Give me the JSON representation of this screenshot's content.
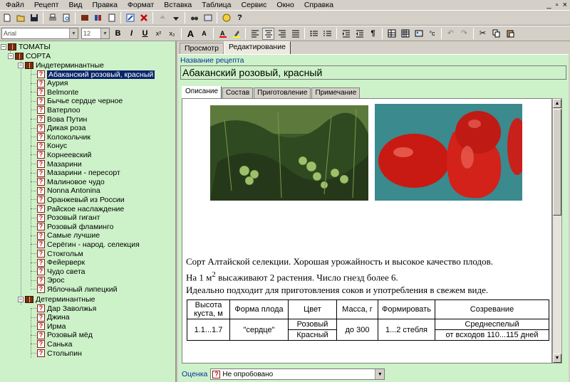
{
  "menu": {
    "items": [
      "Файл",
      "Рецепт",
      "Вид",
      "Правка",
      "Формат",
      "Вставка",
      "Таблица",
      "Сервис",
      "Окно",
      "Справка"
    ],
    "window_controls": [
      "_",
      "▫",
      "×"
    ]
  },
  "format_bar": {
    "font": "Arial",
    "font_size": "12",
    "bold": "B",
    "italic": "I",
    "underline": "U",
    "superscript": "x²",
    "subscript": "x₂",
    "grow_font": "A",
    "shrink_font": "A"
  },
  "tree": {
    "root": "ТОМАТЫ",
    "category": "СОРТА",
    "groups": [
      {
        "label": "Индетерминантные",
        "items": [
          "Абаканский розовый, красный",
          "Аурия",
          "Belmonte",
          "Бычье сердце черное",
          "Ватерлоо",
          "Вова Путин",
          "Дикая роза",
          "Колокольчик",
          "Конус",
          "Корнеевский",
          "Мазарини",
          "Мазарини - пересорт",
          "Малиновое чудо",
          "Nonna Antonina",
          "Оранжевый из России",
          "Райское наслаждение",
          "Розовый гигант",
          "Розовый фламинго",
          "Самые лучшие",
          "Серёгин - народ. селекция",
          "Стокгольм",
          "Фейерверк",
          "Чудо света",
          "Эрос",
          "Яблочный липецкий"
        ]
      },
      {
        "label": "Детерминантные",
        "items": [
          "Дар Заволжья",
          "Джина",
          "Ирма",
          "Розовый мёд",
          "Санька",
          "Столыпин"
        ]
      }
    ]
  },
  "tabs": {
    "main": [
      "Просмотр",
      "Редактирование"
    ],
    "sub": [
      "Описание",
      "Состав",
      "Приготовление",
      "Примечание"
    ]
  },
  "recipe": {
    "name_label": "Название рецепта",
    "name": "Абаканский розовый, красный",
    "desc_line1": "Сорт Алтайской селекции. Хорошая урожайность и высокое качество плодов.",
    "desc_line2_pre": "На 1 м",
    "desc_line2_sup": "2",
    "desc_line2_post": " высаживают 2 растения. Число гнезд более 6.",
    "desc_line3": "Идеально подходит для приготовления соков и употребления в свежем виде."
  },
  "table": {
    "headers": [
      "Высота куста, м",
      "Форма плода",
      "Цвет",
      "Масса, г",
      "Формировать",
      "Созревание"
    ],
    "height": "1.1...1.7",
    "shape": "\"сердце\"",
    "colors": [
      "Розовый",
      "Красный"
    ],
    "mass": "до 300",
    "forming": "1...2 стебля",
    "ripening": [
      "Среднеспелый",
      "от всходов 110...115 дней"
    ]
  },
  "rating": {
    "label": "Оценка",
    "value": "Не опробовано"
  },
  "colors": {
    "tree_bg": "#cdf2c9",
    "selection": "#0a246a",
    "label_blue": "#0a2f9a"
  }
}
